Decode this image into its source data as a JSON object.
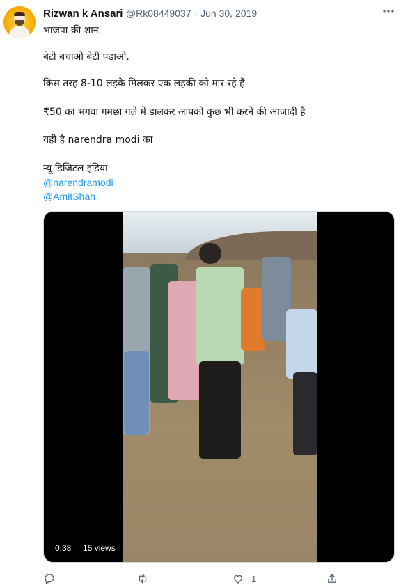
{
  "tweet": {
    "author_name": "Rizwan k Ansari",
    "author_handle": "@Rk08449037",
    "separator": "·",
    "date": "Jun 30, 2019",
    "lines": [
      "भाजपा की शान",
      "बेटी बचाओ बेटी पढ़ाओ.",
      "किस तरह 8-10 लड़के मिलकर एक लड़की को मार रहे हैं",
      "₹50 का भगवा गमछा गले में  डालकर आपको कुछ भी करने की आजादी है",
      "यही है narendra modi का",
      "न्यू डिजिटल इंडिया"
    ],
    "mentions": [
      "@narendramodi",
      "@AmitShah"
    ]
  },
  "video": {
    "duration": "0:38",
    "views": "15 views"
  },
  "actions": {
    "reply_count": "",
    "retweet_count": "",
    "like_count": "1",
    "share_count": ""
  },
  "colors": {
    "link": "#1d9bf0",
    "secondary_text": "#536471",
    "avatar_background": "#f5a800"
  },
  "icons": [
    "more-icon",
    "reply-icon",
    "retweet-icon",
    "like-icon",
    "share-icon"
  ]
}
